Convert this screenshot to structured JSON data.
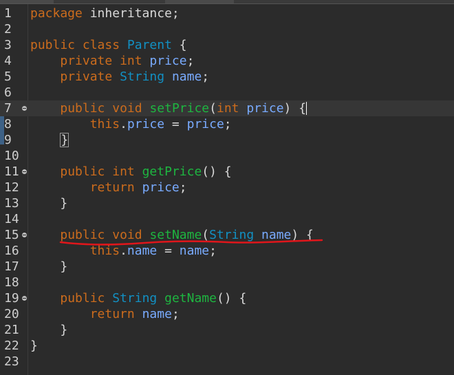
{
  "editor": {
    "lines": [
      {
        "n": "1",
        "tokens": [
          {
            "t": "package",
            "c": "kw"
          },
          {
            "t": " inheritance;",
            "c": "txt"
          }
        ]
      },
      {
        "n": "2",
        "tokens": []
      },
      {
        "n": "3",
        "tokens": [
          {
            "t": "public",
            "c": "kw"
          },
          {
            "t": " ",
            "c": "txt"
          },
          {
            "t": "class",
            "c": "kw"
          },
          {
            "t": " ",
            "c": "txt"
          },
          {
            "t": "Parent",
            "c": "cls"
          },
          {
            "t": " {",
            "c": "txt"
          }
        ]
      },
      {
        "n": "4",
        "tokens": [
          {
            "t": "    ",
            "c": "txt"
          },
          {
            "t": "private",
            "c": "kw"
          },
          {
            "t": " ",
            "c": "txt"
          },
          {
            "t": "int",
            "c": "kw"
          },
          {
            "t": " ",
            "c": "txt"
          },
          {
            "t": "price",
            "c": "var"
          },
          {
            "t": ";",
            "c": "txt"
          }
        ]
      },
      {
        "n": "5",
        "tokens": [
          {
            "t": "    ",
            "c": "txt"
          },
          {
            "t": "private",
            "c": "kw"
          },
          {
            "t": " ",
            "c": "txt"
          },
          {
            "t": "String",
            "c": "cls"
          },
          {
            "t": " ",
            "c": "txt"
          },
          {
            "t": "name",
            "c": "var"
          },
          {
            "t": ";",
            "c": "txt"
          }
        ]
      },
      {
        "n": "6",
        "tokens": []
      },
      {
        "n": "7",
        "fold": true,
        "current": true,
        "caret": true,
        "tokens": [
          {
            "t": "    ",
            "c": "txt"
          },
          {
            "t": "public",
            "c": "kw"
          },
          {
            "t": " ",
            "c": "txt"
          },
          {
            "t": "void",
            "c": "kw"
          },
          {
            "t": " ",
            "c": "txt"
          },
          {
            "t": "setPrice",
            "c": "fn"
          },
          {
            "t": "(",
            "c": "txt"
          },
          {
            "t": "int",
            "c": "kw"
          },
          {
            "t": " ",
            "c": "txt"
          },
          {
            "t": "price",
            "c": "var"
          },
          {
            "t": ") {",
            "c": "txt"
          }
        ]
      },
      {
        "n": "8",
        "tokens": [
          {
            "t": "        ",
            "c": "txt"
          },
          {
            "t": "this",
            "c": "kw"
          },
          {
            "t": ".",
            "c": "txt"
          },
          {
            "t": "price",
            "c": "var"
          },
          {
            "t": " = ",
            "c": "txt"
          },
          {
            "t": "price",
            "c": "var"
          },
          {
            "t": ";",
            "c": "txt"
          }
        ]
      },
      {
        "n": "9",
        "bracketBox": true,
        "tokens": [
          {
            "t": "    ",
            "c": "txt"
          },
          {
            "t": "}",
            "c": "txt",
            "box": true
          }
        ]
      },
      {
        "n": "10",
        "tokens": []
      },
      {
        "n": "11",
        "fold": true,
        "tokens": [
          {
            "t": "    ",
            "c": "txt"
          },
          {
            "t": "public",
            "c": "kw"
          },
          {
            "t": " ",
            "c": "txt"
          },
          {
            "t": "int",
            "c": "kw"
          },
          {
            "t": " ",
            "c": "txt"
          },
          {
            "t": "getPrice",
            "c": "fn"
          },
          {
            "t": "() {",
            "c": "txt"
          }
        ]
      },
      {
        "n": "12",
        "tokens": [
          {
            "t": "        ",
            "c": "txt"
          },
          {
            "t": "return",
            "c": "kw"
          },
          {
            "t": " ",
            "c": "txt"
          },
          {
            "t": "price",
            "c": "var"
          },
          {
            "t": ";",
            "c": "txt"
          }
        ]
      },
      {
        "n": "13",
        "tokens": [
          {
            "t": "    }",
            "c": "txt"
          }
        ]
      },
      {
        "n": "14",
        "tokens": []
      },
      {
        "n": "15",
        "fold": true,
        "tokens": [
          {
            "t": "    ",
            "c": "txt"
          },
          {
            "t": "public",
            "c": "kw"
          },
          {
            "t": " ",
            "c": "txt"
          },
          {
            "t": "void",
            "c": "kw"
          },
          {
            "t": " ",
            "c": "txt"
          },
          {
            "t": "setName",
            "c": "fn"
          },
          {
            "t": "(",
            "c": "txt"
          },
          {
            "t": "String",
            "c": "cls"
          },
          {
            "t": " ",
            "c": "txt"
          },
          {
            "t": "name",
            "c": "var"
          },
          {
            "t": ") {",
            "c": "txt"
          }
        ]
      },
      {
        "n": "16",
        "tokens": [
          {
            "t": "        ",
            "c": "txt"
          },
          {
            "t": "this",
            "c": "kw"
          },
          {
            "t": ".",
            "c": "txt"
          },
          {
            "t": "name",
            "c": "var"
          },
          {
            "t": " = ",
            "c": "txt"
          },
          {
            "t": "name",
            "c": "var"
          },
          {
            "t": ";",
            "c": "txt"
          }
        ]
      },
      {
        "n": "17",
        "tokens": [
          {
            "t": "    }",
            "c": "txt"
          }
        ]
      },
      {
        "n": "18",
        "tokens": []
      },
      {
        "n": "19",
        "fold": true,
        "tokens": [
          {
            "t": "    ",
            "c": "txt"
          },
          {
            "t": "public",
            "c": "kw"
          },
          {
            "t": " ",
            "c": "txt"
          },
          {
            "t": "String",
            "c": "cls"
          },
          {
            "t": " ",
            "c": "txt"
          },
          {
            "t": "getName",
            "c": "fn"
          },
          {
            "t": "() {",
            "c": "txt"
          }
        ]
      },
      {
        "n": "20",
        "tokens": [
          {
            "t": "        ",
            "c": "txt"
          },
          {
            "t": "return",
            "c": "kw"
          },
          {
            "t": " ",
            "c": "txt"
          },
          {
            "t": "name",
            "c": "var"
          },
          {
            "t": ";",
            "c": "txt"
          }
        ]
      },
      {
        "n": "21",
        "tokens": [
          {
            "t": "    }",
            "c": "txt"
          }
        ]
      },
      {
        "n": "22",
        "tokens": [
          {
            "t": "}",
            "c": "txt"
          }
        ]
      },
      {
        "n": "23",
        "tokens": []
      }
    ]
  },
  "colors": {
    "background": "#2b2b2b",
    "keyword": "#cc6c1d",
    "type": "#1290c3",
    "method": "#1eb540",
    "field": "#79abff",
    "annotation_stroke": "#e0161b"
  },
  "icons": {
    "fold": "fold-collapse-icon"
  }
}
